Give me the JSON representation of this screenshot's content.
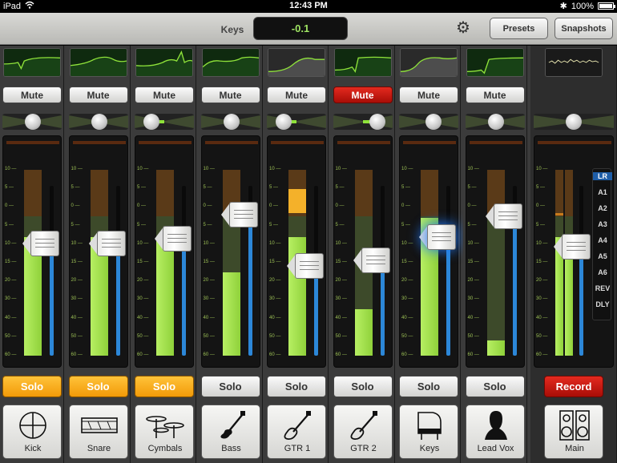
{
  "status": {
    "device": "iPad",
    "time": "12:43 PM",
    "battery": "100%"
  },
  "topbar": {
    "param_label": "Keys",
    "value": "-0.1",
    "presets_label": "Presets",
    "snapshots_label": "Snapshots"
  },
  "scale_labels": [
    "10",
    "5",
    "0",
    "5",
    "10",
    "15",
    "20",
    "30",
    "40",
    "50",
    "60"
  ],
  "channels": [
    {
      "name": "Kick",
      "mute": "Mute",
      "mute_on": false,
      "solo": "Solo",
      "solo_on": true,
      "icon": "kick-drum-icon",
      "eq": "curve1",
      "pan": 0.5,
      "fader": 0.66,
      "meter": 0.64,
      "pan_bar": 0
    },
    {
      "name": "Snare",
      "mute": "Mute",
      "mute_on": false,
      "solo": "Solo",
      "solo_on": true,
      "icon": "snare-drum-icon",
      "eq": "curve2",
      "pan": 0.5,
      "fader": 0.66,
      "meter": 0.64,
      "pan_bar": 0
    },
    {
      "name": "Cymbals",
      "mute": "Mute",
      "mute_on": false,
      "solo": "Solo",
      "solo_on": true,
      "icon": "cymbals-icon",
      "eq": "curve3",
      "pan": 0.15,
      "fader": 0.69,
      "meter": 0.62,
      "pan_bar": 0.3
    },
    {
      "name": "Bass",
      "mute": "Mute",
      "mute_on": false,
      "solo": "Solo",
      "solo_on": false,
      "icon": "bass-guitar-icon",
      "eq": "curve4",
      "pan": 0.5,
      "fader": 0.83,
      "meter": 0.45,
      "pan_bar": 0
    },
    {
      "name": "GTR 1",
      "mute": "Mute",
      "mute_on": false,
      "solo": "Solo",
      "solo_on": false,
      "icon": "guitar-icon",
      "eq": "curve5",
      "pan": 0.15,
      "fader": 0.53,
      "meter": 0.64,
      "pan_bar": 0.35
    },
    {
      "name": "GTR 2",
      "mute": "Mute",
      "mute_on": true,
      "solo": "Solo",
      "solo_on": false,
      "icon": "guitar-icon",
      "eq": "curve6",
      "pan": 0.85,
      "fader": 0.56,
      "meter": 0.25,
      "pan_bar": 0.35
    },
    {
      "name": "Keys",
      "mute": "Mute",
      "mute_on": false,
      "solo": "Solo",
      "solo_on": false,
      "icon": "piano-icon",
      "eq": "curve7",
      "pan": 0.6,
      "fader": 0.7,
      "meter": 0.74,
      "pan_bar": 0.1
    },
    {
      "name": "Lead Vox",
      "mute": "Mute",
      "mute_on": false,
      "solo": "Solo",
      "solo_on": false,
      "icon": "vocalist-icon",
      "eq": "curve8",
      "pan": 0.5,
      "fader": 0.82,
      "meter": 0.08,
      "pan_bar": 0
    }
  ],
  "main": {
    "name": "Main",
    "record_label": "Record",
    "icon": "speaker-icon",
    "pan": 0.5,
    "fader": 0.64,
    "meter": 0.64,
    "buses": [
      "LR",
      "A1",
      "A2",
      "A3",
      "A4",
      "A5",
      "A6",
      "REV",
      "DLY"
    ],
    "selected_bus": "LR"
  }
}
